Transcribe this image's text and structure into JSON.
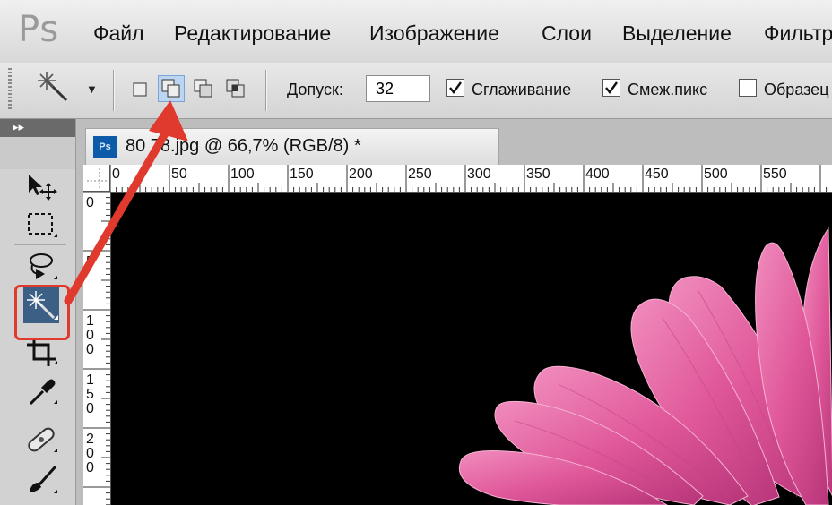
{
  "app": {
    "logo": "Ps"
  },
  "menu": {
    "items": [
      "Файл",
      "Редактирование",
      "Изображение",
      "Слои",
      "Выделение",
      "Фильтр"
    ]
  },
  "options": {
    "tolerance_label": "Допуск:",
    "tolerance_value": "32",
    "antialias_label": "Сглаживание",
    "antialias_checked": true,
    "contiguous_label": "Смеж.пикс",
    "contiguous_checked": true,
    "sample_all_label": "Образец",
    "sample_all_checked": false
  },
  "toolbox": {
    "collapse_glyph": "▸▸"
  },
  "document": {
    "icon_text": "Ps",
    "title": "80  78.jpg @ 66,7% (RGB/8) *",
    "ruler_h_labels": [
      "0",
      "50",
      "100",
      "150",
      "200",
      "250",
      "300",
      "350",
      "400",
      "450",
      "500",
      "550"
    ],
    "ruler_v_labels": [
      [
        "0"
      ],
      [
        "5"
      ],
      [
        "1",
        "0",
        "0"
      ],
      [
        "1",
        "5",
        "0"
      ],
      [
        "2",
        "0",
        "0"
      ]
    ]
  },
  "colors": {
    "highlight": "#e03a2f",
    "arrow": "#e03a2f",
    "selection_blue": "#3c5f86",
    "petal_pink": "#e05a9a"
  },
  "icons": {
    "preset": "magic-wand-icon",
    "move": "move-tool-icon",
    "marquee": "rect-marquee-icon",
    "lasso": "lasso-icon",
    "wand": "magic-wand-icon",
    "crop": "crop-icon",
    "eyedropper": "eyedropper-icon",
    "healing": "healing-brush-icon",
    "brush": "brush-icon"
  }
}
